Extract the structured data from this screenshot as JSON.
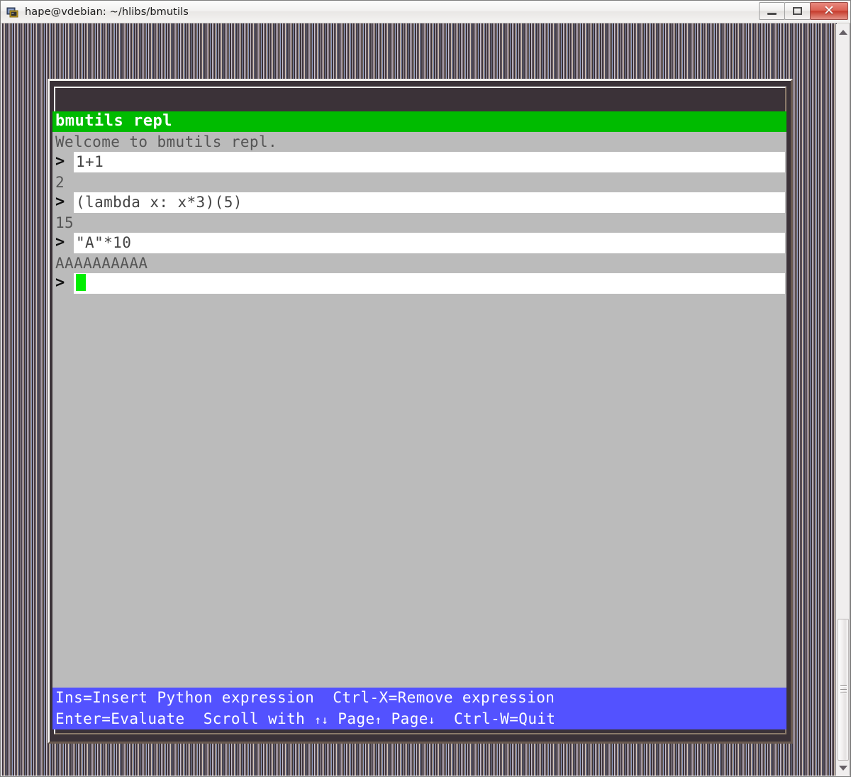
{
  "window": {
    "title": "hape@vdebian: ~/hlibs/bmutils",
    "icon": "terminal-icon",
    "buttons": {
      "minimize": "minimize-button",
      "maximize": "maximize-button",
      "close": "✕"
    }
  },
  "colors": {
    "title_bar_green": "#00bb00",
    "content_grey": "#bbbbbb",
    "input_white": "#ffffff",
    "cursor_green": "#00ee00",
    "status_blue": "#5352ff",
    "frame_dark": "#3b3238"
  },
  "repl": {
    "title": "bmutils repl",
    "welcome": "Welcome to bmutils repl.",
    "prompt_symbol": ">",
    "entries": [
      {
        "input": "1+1",
        "output": "2"
      },
      {
        "input": "(lambda x: x*3)(5)",
        "output": "15"
      },
      {
        "input": "\"A\"*10",
        "output": "AAAAAAAAAA"
      }
    ],
    "current_input": ""
  },
  "statusbar": {
    "line1_a": "Ins=Insert Python expression",
    "line1_b": "Ctrl-X=Remove expression",
    "line2_a": "Enter=Evaluate",
    "line2_b": "Scroll with",
    "line2_arrows": "↑↓",
    "line2_c": "Page",
    "line2_c_arrow": "↑",
    "line2_d": "Page",
    "line2_d_arrow": "↓",
    "line2_e": "Ctrl-W=Quit"
  },
  "scrollbar": {
    "up_arrow": "scroll-up-arrow",
    "down_arrow": "scroll-down-arrow"
  }
}
